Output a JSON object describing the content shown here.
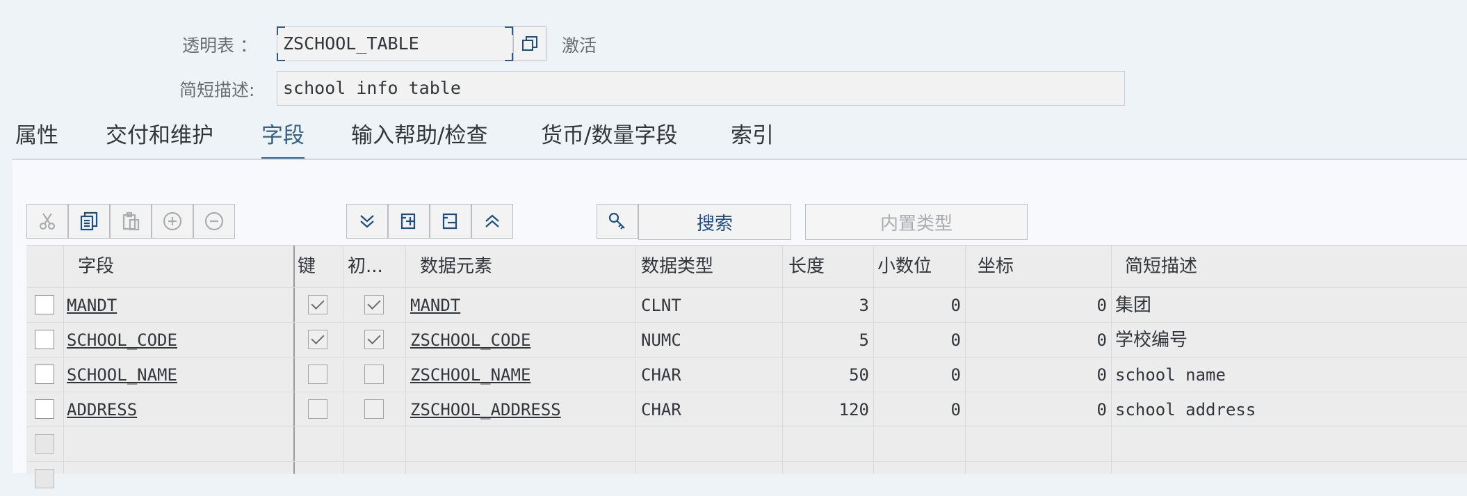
{
  "header": {
    "table_label": "透明表 ：",
    "table_name": "ZSCHOOL_TABLE",
    "status": "激活",
    "desc_label": "简短描述:",
    "desc_value": "school info table"
  },
  "tabs": [
    {
      "label": "属性"
    },
    {
      "label": "交付和维护"
    },
    {
      "label": "字段",
      "active": true
    },
    {
      "label": "输入帮助/检查"
    },
    {
      "label": "货币/数量字段"
    },
    {
      "label": "索引"
    }
  ],
  "toolbar": {
    "search_label": "搜索",
    "builtin_type_label": "内置类型"
  },
  "grid": {
    "columns": [
      "字段",
      "键",
      "初...",
      "数据元素",
      "数据类型",
      "长度",
      "小数位",
      "坐标",
      "简短描述"
    ],
    "rows": [
      {
        "field": "MANDT",
        "key": true,
        "init": true,
        "element": "MANDT",
        "type": "CLNT",
        "length": "3",
        "decimals": "0",
        "coord": "0",
        "desc": "集团"
      },
      {
        "field": "SCHOOL_CODE",
        "key": true,
        "init": true,
        "element": "ZSCHOOL_CODE",
        "type": "NUMC",
        "length": "5",
        "decimals": "0",
        "coord": "0",
        "desc": "学校编号"
      },
      {
        "field": "SCHOOL_NAME",
        "key": false,
        "init": false,
        "element": "ZSCHOOL_NAME",
        "type": "CHAR",
        "length": "50",
        "decimals": "0",
        "coord": "0",
        "desc": "school name"
      },
      {
        "field": "ADDRESS",
        "key": false,
        "init": false,
        "element": "ZSCHOOL_ADDRESS",
        "type": "CHAR",
        "length": "120",
        "decimals": "0",
        "coord": "0",
        "desc": "school address"
      }
    ]
  },
  "colors": {
    "accent": "#346187",
    "icon": "#1d4e80"
  }
}
